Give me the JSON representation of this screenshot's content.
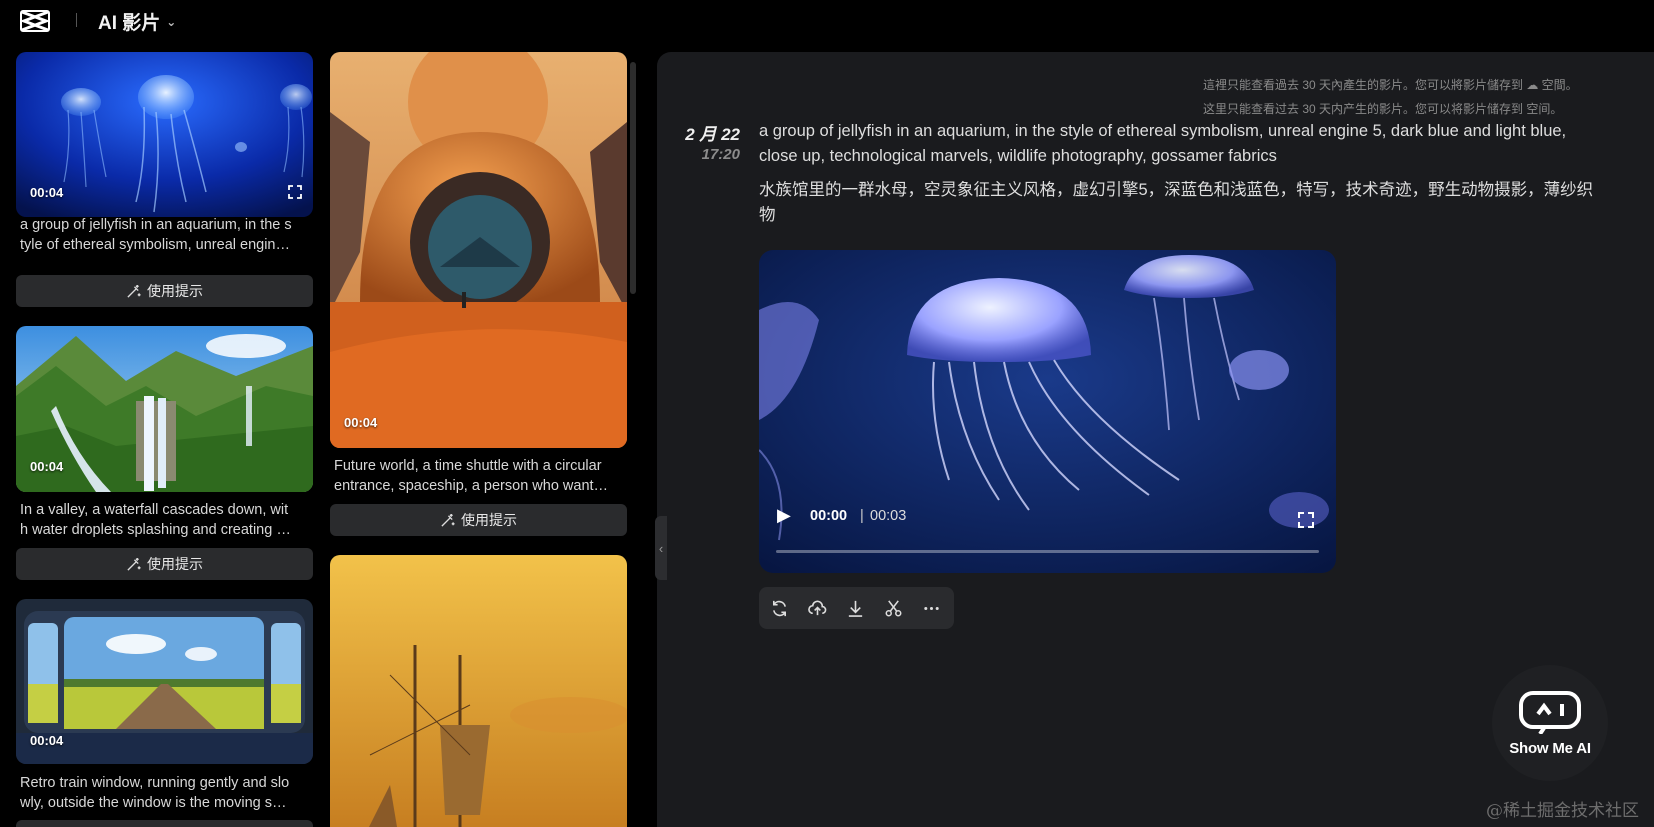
{
  "header": {
    "app_title": "AI 影片",
    "logo_icon": "capcut-logo-icon",
    "dropdown_icon": "chevron-down-icon"
  },
  "gallery": {
    "cards": [
      {
        "duration": "00:04",
        "caption": "a group of jellyfish in an aquarium, in the style of ethereal symbolism, unreal engin…",
        "caption_lines": [
          "a group of jellyfish in an aquarium, in the s",
          "tyle of ethereal symbolism, unreal engin…"
        ],
        "prompt_label": "使用提示"
      },
      {
        "duration": "00:04",
        "caption_lines": [
          "In a valley, a waterfall cascades down, wit",
          "h water droplets splashing and creating …"
        ],
        "prompt_label": "使用提示"
      },
      {
        "duration": "00:04",
        "caption_lines": [
          "Retro train window, running gently and slo",
          "wly, outside the window is the moving s…"
        ]
      },
      {
        "duration": "00:04",
        "caption_lines": [
          "Future world, a time shuttle with a circular",
          "entrance, spaceship, a person who want…"
        ],
        "prompt_label": "使用提示"
      }
    ]
  },
  "detail": {
    "notice_lines": [
      "這裡只能查看過去 30 天內產生的影片。您可以將影片儲存到 ☁ 空間。",
      "这里只能查看过去 30 天内产生的影片。您可以将影片储存到 空间。"
    ],
    "date": "2 月 22",
    "time": "17:20",
    "prompt_en": "a group of jellyfish in an aquarium, in the style of ethereal symbolism, unreal engine 5, dark blue and light blue, close up, technological marvels, wildlife photography, gossamer fabrics",
    "prompt_zh": "水族馆里的一群水母，空灵象征主义风格，虚幻引擎5，深蓝色和浅蓝色，特写，技术奇迹，野生动物摄影，薄纱织物",
    "player": {
      "current_time": "00:00",
      "separator": "|",
      "total_time": "00:03",
      "progress": 0
    },
    "toolbar": [
      "regenerate-icon",
      "cloud-upload-icon",
      "download-icon",
      "scissors-icon",
      "more-icon"
    ]
  },
  "badge": {
    "label": "Show Me AI"
  },
  "watermark": "@稀土掘金技术社区",
  "colors": {
    "background": "#000000",
    "panel": "#1a1b1e",
    "button": "#2a2b2d"
  }
}
